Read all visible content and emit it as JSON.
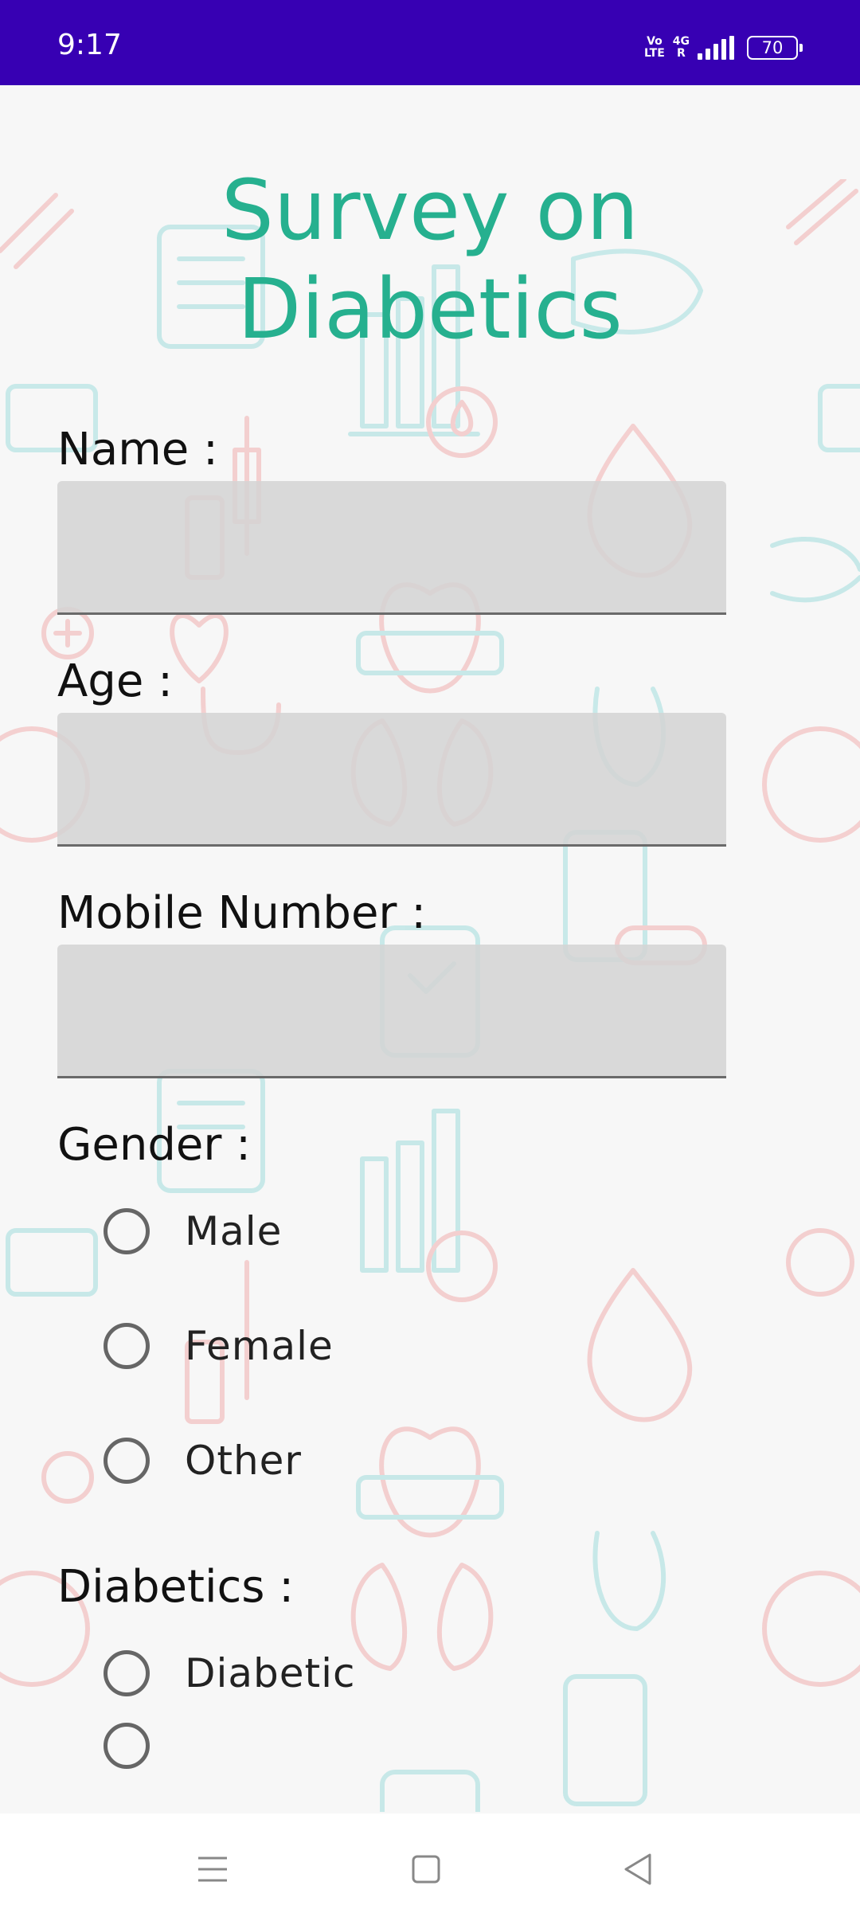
{
  "status_bar": {
    "time": "9:17",
    "volte": "Vo\nLTE",
    "network": "4G\nR",
    "battery": "70"
  },
  "form": {
    "title": "Survey on\nDiabetics",
    "name_label": "Name :",
    "age_label": "Age :",
    "mobile_label": "Mobile Number :",
    "name_value": "",
    "age_value": "",
    "mobile_value": "",
    "gender_label": "Gender :",
    "gender_options": [
      "Male",
      "Female",
      "Other"
    ],
    "diabetics_label": "Diabetics :",
    "diabetics_options": [
      "Diabetic",
      ""
    ]
  },
  "colors": {
    "status_bar": "#3700b3",
    "title": "#26b08f",
    "pattern_teal": "#8fd8d8",
    "pattern_red": "#f0a0a0"
  },
  "nav_bar": {
    "icons": [
      "menu-icon",
      "home-icon",
      "back-icon"
    ]
  }
}
